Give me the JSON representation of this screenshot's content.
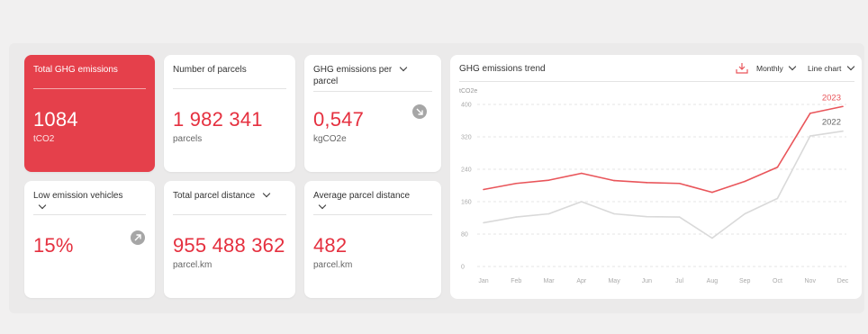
{
  "cards": {
    "total": {
      "title": "Total GHG emissions",
      "value": "1084",
      "unit": "tCO2"
    },
    "parcels": {
      "title": "Number of parcels",
      "value": "1 982 341",
      "unit": "parcels"
    },
    "per_parcel": {
      "title_line1": "GHG emissions per",
      "title_line2": "parcel",
      "value": "0,547",
      "unit": "kgCO2e",
      "trend_icon": "arrow-down-right-icon"
    },
    "low_emission": {
      "title": "Low emission vehicles",
      "value": "15%",
      "trend_icon": "arrow-up-right-icon"
    },
    "distance": {
      "title": "Total parcel distance",
      "value": "955 488 362",
      "unit": "parcel.km"
    },
    "avg_distance": {
      "title": "Average parcel distance",
      "value": "482",
      "unit": "parcel.km"
    }
  },
  "trend": {
    "title": "GHG emissions trend",
    "download_icon": "download-icon",
    "period_label": "Monthly",
    "chart_type_label": "Line chart",
    "colors": {
      "2023": "#e9555a",
      "2022": "#d9d9d9"
    }
  },
  "chart_data": {
    "type": "line",
    "ylabel": "tCO2e",
    "ylim": [
      0,
      400
    ],
    "yticks": [
      "0",
      "80",
      "160",
      "240",
      "320",
      "400"
    ],
    "categories": [
      "Jan",
      "Feb",
      "Mar",
      "Apr",
      "May",
      "Jun",
      "Jul",
      "Aug",
      "Sep",
      "Oct",
      "Nov",
      "Dec"
    ],
    "grid": true,
    "series": [
      {
        "name": "2023",
        "values": [
          190,
          205,
          213,
          230,
          212,
          207,
          205,
          183,
          210,
          245,
          378,
          395
        ]
      },
      {
        "name": "2022",
        "values": [
          108,
          122,
          130,
          160,
          130,
          123,
          122,
          70,
          130,
          168,
          322,
          334
        ]
      }
    ]
  }
}
